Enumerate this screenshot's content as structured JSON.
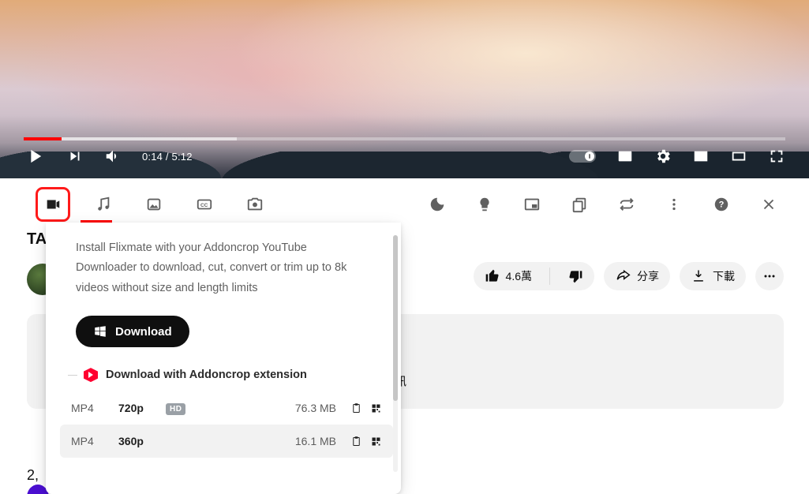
{
  "player": {
    "time_current": "0:14",
    "time_sep": " / ",
    "time_total": "5:12"
  },
  "page": {
    "title_fragment": "TA",
    "description_fragment": "訊",
    "comment_count_fragment": "2,"
  },
  "chips": {
    "like_count": "4.6萬",
    "share_label": "分享",
    "download_label": "下載"
  },
  "popup": {
    "promo_text": "Install Flixmate with your Addoncrop YouTube Downloader to download, cut, convert or trim up to 8k videos without size and length limits",
    "download_btn": "Download",
    "section_title": "Download with Addoncrop extension",
    "rows": [
      {
        "format": "MP4",
        "quality": "720p",
        "hd": "HD",
        "size": "76.3 MB"
      },
      {
        "format": "MP4",
        "quality": "360p",
        "hd": "",
        "size": "16.1 MB"
      }
    ]
  }
}
